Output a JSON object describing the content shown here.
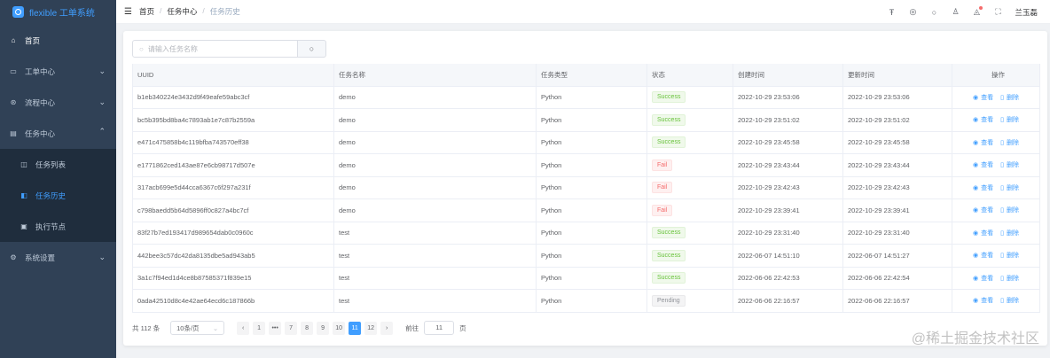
{
  "app": {
    "logo_text": "flexible 工单系统"
  },
  "sidebar": {
    "items": [
      {
        "label": "首页",
        "icon": "home-icon"
      },
      {
        "label": "工单中心",
        "icon": "ticket-icon"
      },
      {
        "label": "流程中心",
        "icon": "process-icon"
      },
      {
        "label": "任务中心",
        "icon": "task-icon"
      },
      {
        "label": "任务列表",
        "icon": "list-icon"
      },
      {
        "label": "任务历史",
        "icon": "history-icon"
      },
      {
        "label": "执行节点",
        "icon": "node-icon"
      },
      {
        "label": "系统设置",
        "icon": "gear-icon"
      }
    ]
  },
  "breadcrumb": {
    "home": "首页",
    "sep": "/",
    "section": "任务中心",
    "current": "任务历史"
  },
  "navbar": {
    "user": "兰玉磊"
  },
  "search": {
    "placeholder": "请输入任务名称",
    "value": ""
  },
  "table": {
    "headers": [
      "UUID",
      "任务名称",
      "任务类型",
      "状态",
      "创建时间",
      "更新时间",
      "操作"
    ],
    "view_label": "查看",
    "delete_label": "删除",
    "rows": [
      [
        "b1eb340224e3432d9f49eafe59abc3cf",
        "demo",
        "Python",
        "Success",
        "2022-10-29 23:53:06",
        "2022-10-29 23:53:06"
      ],
      [
        "bc5b395bd8ba4c7893ab1e7c87b2559a",
        "demo",
        "Python",
        "Success",
        "2022-10-29 23:51:02",
        "2022-10-29 23:51:02"
      ],
      [
        "e471c475858b4c119bfba743570eff38",
        "demo",
        "Python",
        "Success",
        "2022-10-29 23:45:58",
        "2022-10-29 23:45:58"
      ],
      [
        "e1771862ced143ae87e6cb98717d507e",
        "demo",
        "Python",
        "Fail",
        "2022-10-29 23:43:44",
        "2022-10-29 23:43:44"
      ],
      [
        "317acb699e5d44cca6367c6f297a231f",
        "demo",
        "Python",
        "Fail",
        "2022-10-29 23:42:43",
        "2022-10-29 23:42:43"
      ],
      [
        "c798baedd5b64d5896ff0c827a4bc7cf",
        "demo",
        "Python",
        "Fail",
        "2022-10-29 23:39:41",
        "2022-10-29 23:39:41"
      ],
      [
        "83f27b7ed193417d989654dab0c0960c",
        "test",
        "Python",
        "Success",
        "2022-10-29 23:31:40",
        "2022-10-29 23:31:40"
      ],
      [
        "442bee3c57dc42da8135dbe5ad943ab5",
        "test",
        "Python",
        "Success",
        "2022-06-07 14:51:10",
        "2022-06-07 14:51:27"
      ],
      [
        "3a1c7f94ed1d4ce8b87585371f839e15",
        "test",
        "Python",
        "Success",
        "2022-06-06 22:42:53",
        "2022-06-06 22:42:54"
      ],
      [
        "0ada42510d8c4e42ae64ecd6c187866b",
        "test",
        "Python",
        "Pending",
        "2022-06-06 22:16:57",
        "2022-06-06 22:16:57"
      ]
    ]
  },
  "pagination": {
    "total": "共 112 条",
    "page_size": "10条/页",
    "pages": [
      "1",
      "•••",
      "7",
      "8",
      "9",
      "10",
      "11",
      "12"
    ],
    "current": "11",
    "goto_label": "前往",
    "goto_value": "11",
    "goto_suffix": "页"
  },
  "watermark": "@稀土掘金技术社区",
  "colors": {
    "sidebar": "#304156",
    "accent": "#409eff",
    "success": "#67c23a",
    "fail": "#f56c6c",
    "pending": "#909399"
  }
}
